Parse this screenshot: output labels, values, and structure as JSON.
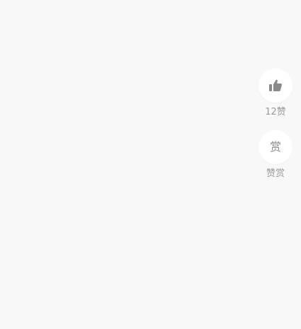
{
  "side_actions": {
    "like": {
      "icon": "thumbs-up-icon",
      "label": "12赞"
    },
    "reward": {
      "icon_text": "赏",
      "label": "赞赏"
    }
  },
  "colors": {
    "background": "#f8f8f8",
    "button_bg": "#ffffff",
    "icon": "#8a8a8a",
    "label": "#9a9a9a"
  }
}
